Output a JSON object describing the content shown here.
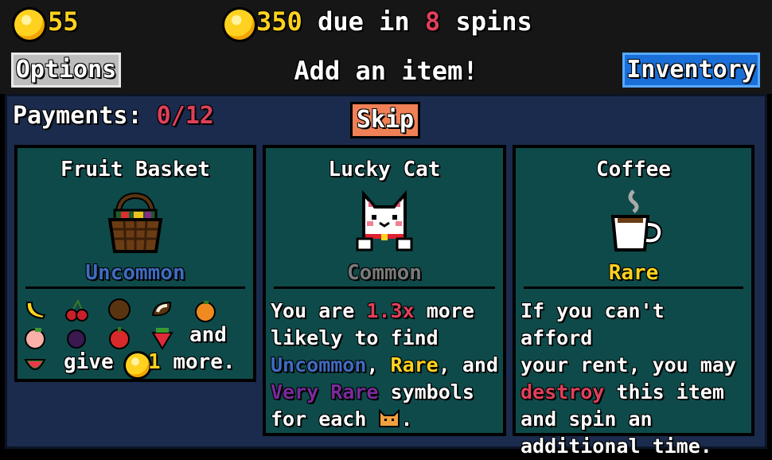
{
  "top_bar": {
    "coins": "55",
    "rent_amount": "350",
    "due_text": "due in",
    "spins_left": "8",
    "spins_text": "spins"
  },
  "header": {
    "options_label": "Options",
    "title": "Add an item!",
    "inventory_label": "Inventory"
  },
  "payments": {
    "label": "Payments:",
    "value": "0/12"
  },
  "skip_label": "Skip",
  "cards": [
    {
      "title": "Fruit Basket",
      "rarity": "Uncommon",
      "icon": "fruit-basket-icon",
      "desc_and": "and",
      "desc_give": "give",
      "desc_amount": "1",
      "desc_more": "more.",
      "fruit_icons": [
        "banana-icon",
        "cherry-icon",
        "coconut-icon",
        "coconut-half-icon",
        "orange-icon",
        "peach-icon",
        "plum-icon",
        "apple-icon",
        "strawberry-icon",
        "watermelon-icon"
      ]
    },
    {
      "title": "Lucky Cat",
      "rarity": "Common",
      "icon": "lucky-cat-icon",
      "desc": {
        "p1": "You are ",
        "mult": "1.3x",
        "p2": " more\nlikely to find\n",
        "uncommon": "Uncommon",
        "p3": ", ",
        "rare": "Rare",
        "p4": ", and\n",
        "very_rare": "Very Rare",
        "p5": " symbols\nfor each ",
        "p6": "."
      }
    },
    {
      "title": "Coffee",
      "rarity": "Rare",
      "icon": "coffee-icon",
      "desc": {
        "p1": "If you can't afford\nyour rent, you may\n",
        "destroy": "destroy",
        "p2": " this item\nand spin an\nadditional time."
      }
    }
  ],
  "colors": {
    "coin": "#ffd21f",
    "rent_red": "#e0405a",
    "panel_bg": "#1b2b4d",
    "card_bg": "#0f4a4a",
    "uncommon": "#3f6cc0",
    "common": "#7a7a7a",
    "rare": "#ffd21f",
    "very_rare": "#7a2a9a",
    "skip_bg": "#f08055",
    "inventory_bg": "#1a6fd8"
  }
}
